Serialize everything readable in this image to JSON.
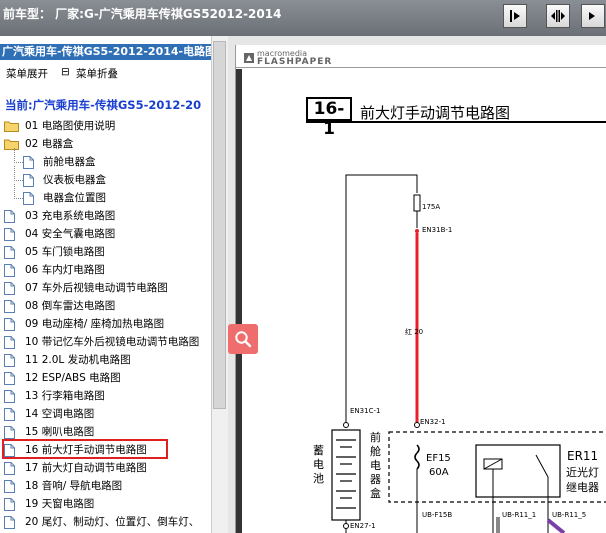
{
  "topbar": {
    "title": "前车型： 厂家:G-广汽乘用车传祺GS52012-2014"
  },
  "sidebar": {
    "header": "广汽乘用车-传祺GS5-2012-2014-电路图",
    "expand_label": "菜单展开",
    "collapse_label": "菜单折叠",
    "current": "当前:广汽乘用车-传祺GS5-2012-20",
    "items": [
      {
        "label": "01 电路图使用说明",
        "type": "folder"
      },
      {
        "label": "02 电器盒",
        "type": "folder-open"
      },
      {
        "label": "前舱电器盒",
        "type": "doc-child"
      },
      {
        "label": "仪表板电器盒",
        "type": "doc-child"
      },
      {
        "label": "电器盒位置图",
        "type": "doc-child"
      },
      {
        "label": "03 充电系统电路图",
        "type": "doc"
      },
      {
        "label": "04 安全气囊电路图",
        "type": "doc"
      },
      {
        "label": "05 车门锁电路图",
        "type": "doc"
      },
      {
        "label": "06 车内灯电路图",
        "type": "doc"
      },
      {
        "label": "07 车外后视镜电动调节电路图",
        "type": "doc"
      },
      {
        "label": "08 倒车雷达电路图",
        "type": "doc"
      },
      {
        "label": "09 电动座椅/ 座椅加热电路图",
        "type": "doc"
      },
      {
        "label": "10 带记忆车外后视镜电动调节电路图",
        "type": "doc"
      },
      {
        "label": "11 2.0L 发动机电路图",
        "type": "doc"
      },
      {
        "label": "12 ESP/ABS 电路图",
        "type": "doc"
      },
      {
        "label": "13 行李箱电路图",
        "type": "doc"
      },
      {
        "label": "14 空调电路图",
        "type": "doc"
      },
      {
        "label": "15 喇叭电路图",
        "type": "doc"
      },
      {
        "label": "16 前大灯手动调节电路图",
        "type": "doc",
        "selected": true
      },
      {
        "label": "17 前大灯自动调节电路图",
        "type": "doc"
      },
      {
        "label": "18 音响/ 导航电路图",
        "type": "doc"
      },
      {
        "label": "19 天窗电路图",
        "type": "doc"
      },
      {
        "label": "20 尾灯、制动灯、位置灯、倒车灯、",
        "type": "doc"
      }
    ]
  },
  "viewer": {
    "brand_small": "macromedia",
    "brand_big": "FLASHPAPER"
  },
  "doc": {
    "number": "16-1",
    "title": "前大灯手动调节电路图",
    "fuse_175": "175A",
    "conn_en31b": "EN31B-1",
    "wire_label": "红 20",
    "conn_en31c": "EN31C-1",
    "conn_en32": "EN32-1",
    "battery_label": [
      "蓄",
      "电",
      "池"
    ],
    "box_label": [
      "前",
      "舱",
      "电",
      "器",
      "盒"
    ],
    "ef15": "EF15",
    "ef15_amp": "60A",
    "er11": "ER11",
    "er11_desc1": "近光灯",
    "er11_desc2": "继电器",
    "conn_en27": "EN27-1",
    "conn_ubf15b": "UB-F15B",
    "conn_ubr11_1": "UB-R11_1",
    "conn_ubr11_5": "UB-R11_5"
  },
  "colors": {
    "wire_red": "#e8202a",
    "wire_purple": "#7a3fa8",
    "selection_border": "#e02020",
    "header_blue": "#2f6fb6"
  }
}
